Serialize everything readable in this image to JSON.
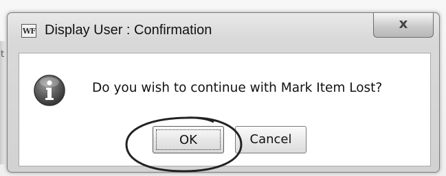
{
  "window": {
    "app_icon_text": "WF",
    "title": "Display User : Confirmation",
    "close_label": "x"
  },
  "background": {
    "edge_glyph": "t"
  },
  "dialog": {
    "icon": "info-icon",
    "message": "Do you wish to continue with Mark Item Lost?",
    "ok_label": "OK",
    "cancel_label": "Cancel"
  },
  "annotation": {
    "type": "ellipse-highlight",
    "target": "ok-button"
  }
}
